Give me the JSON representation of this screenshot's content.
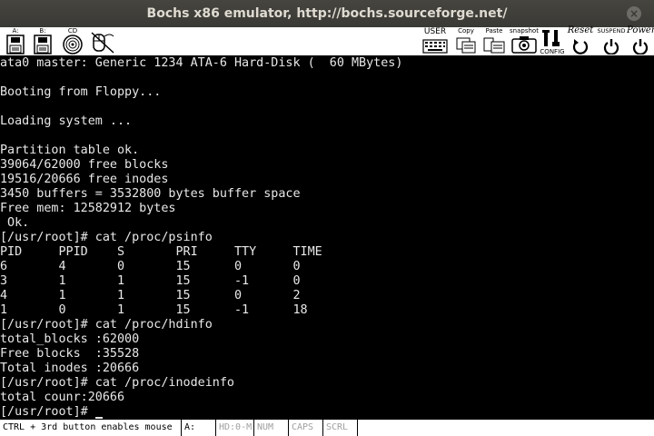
{
  "window": {
    "title": "Bochs x86 emulator, http://bochs.sourceforge.net/",
    "close_glyph": "×"
  },
  "toolbar": {
    "floppy_a": "A:",
    "floppy_b": "B:",
    "cdrom": "CD",
    "user": "USER",
    "copy": "Copy",
    "paste": "Paste",
    "snapshot": "snapshot",
    "config": "CONFIG",
    "reset": "Reset",
    "suspend": "SUSPEND",
    "power": "Power"
  },
  "terminal": {
    "lines": [
      "ata0 master: Generic 1234 ATA-6 Hard-Disk (  60 MBytes)",
      "",
      "Booting from Floppy...",
      "",
      "Loading system ...",
      "",
      "Partition table ok.",
      "39064/62000 free blocks",
      "19516/20666 free inodes",
      "3450 buffers = 3532800 bytes buffer space",
      "Free mem: 12582912 bytes",
      " Ok.",
      "[/usr/root]# cat /proc/psinfo",
      "PID     PPID    S       PRI     TTY     TIME",
      "6       4       0       15      0       0",
      "3       1       1       15      -1      0",
      "4       1       1       15      0       2",
      "1       0       1       15      -1      18",
      "[/usr/root]# cat /proc/hdinfo",
      "total_blocks :62000",
      "Free blocks  :35528",
      "Total inodes :20666",
      "[/usr/root]# cat /proc/inodeinfo",
      "total counr:20666",
      "[/usr/root]# "
    ]
  },
  "statusbar": {
    "message": "CTRL + 3rd button enables mouse",
    "drive_a": "A:",
    "hd": "HD:0-M",
    "num": "NUM",
    "caps": "CAPS",
    "scrl": "SCRL"
  }
}
